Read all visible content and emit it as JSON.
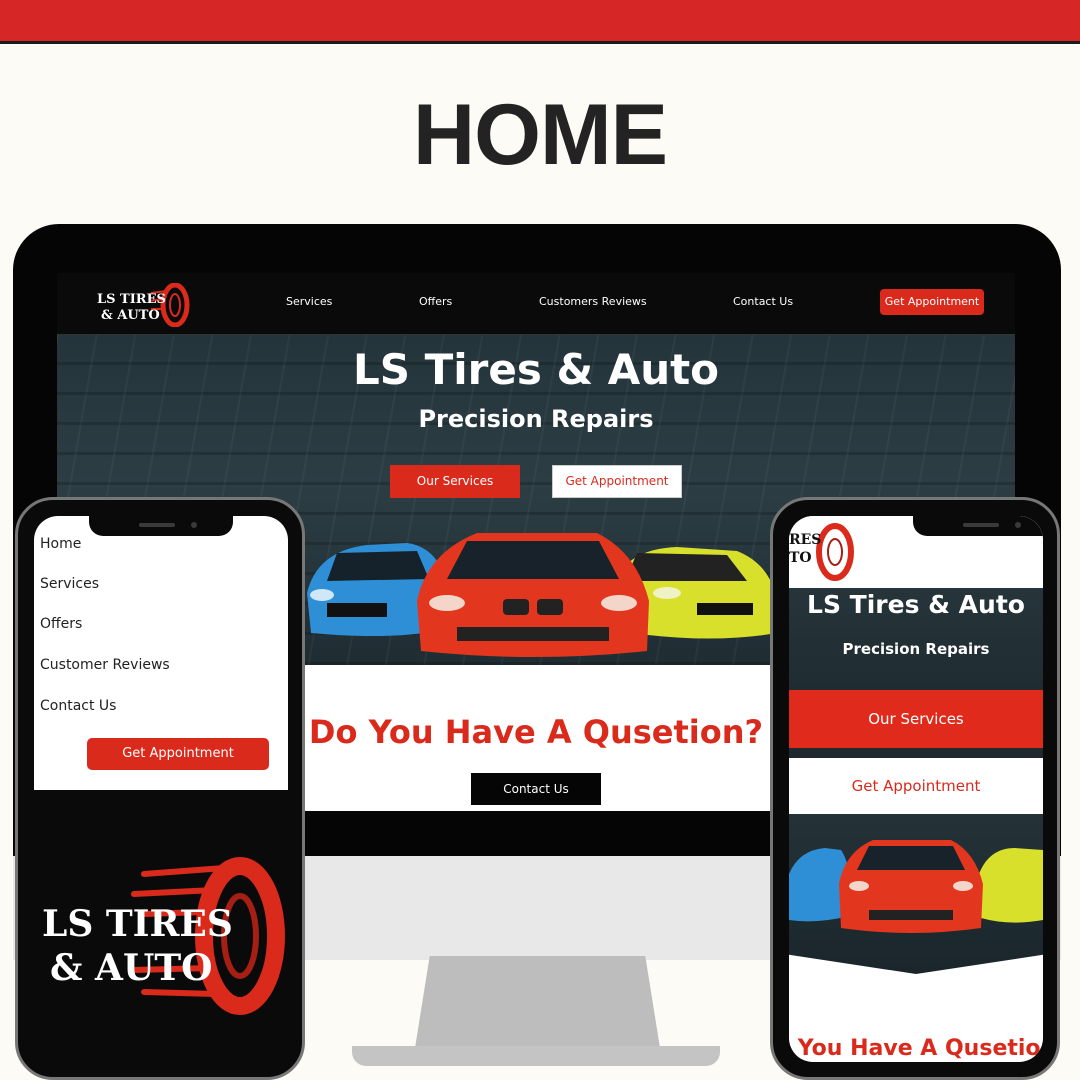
{
  "headline": "HOME",
  "colors": {
    "brand_red": "#d92a1c",
    "dark": "#0a0a0a",
    "hero": "#26353b"
  },
  "desktop": {
    "logo": {
      "line1": "LS TIRES",
      "line2": "& AUTO",
      "icon": "tire-icon"
    },
    "nav": {
      "services": "Services",
      "offers": "Offers",
      "reviews": "Customers Reviews",
      "contact": "Contact Us",
      "appointment": "Get Appointment"
    },
    "hero": {
      "title": "LS Tires & Auto",
      "subtitle": "Precision Repairs",
      "btn_services": "Our Services",
      "btn_appointment": "Get Appointment"
    },
    "question": "Do You Have A Qusetion?",
    "contact_btn": "Contact Us"
  },
  "phone_left": {
    "menu": [
      "Home",
      "Services",
      "Offers",
      "Customer Reviews",
      "Contact Us"
    ],
    "appointment": "Get Appointment",
    "logo": {
      "line1": "LS TIRES",
      "line2": "& AUTO"
    }
  },
  "phone_right": {
    "logo_partial": {
      "line1": "RES",
      "line2": "TO"
    },
    "title": "LS Tires & Auto",
    "subtitle": "Precision Repairs",
    "btn_services": "Our Services",
    "btn_appointment": "Get Appointment",
    "question": "o You Have A Qusetion"
  }
}
